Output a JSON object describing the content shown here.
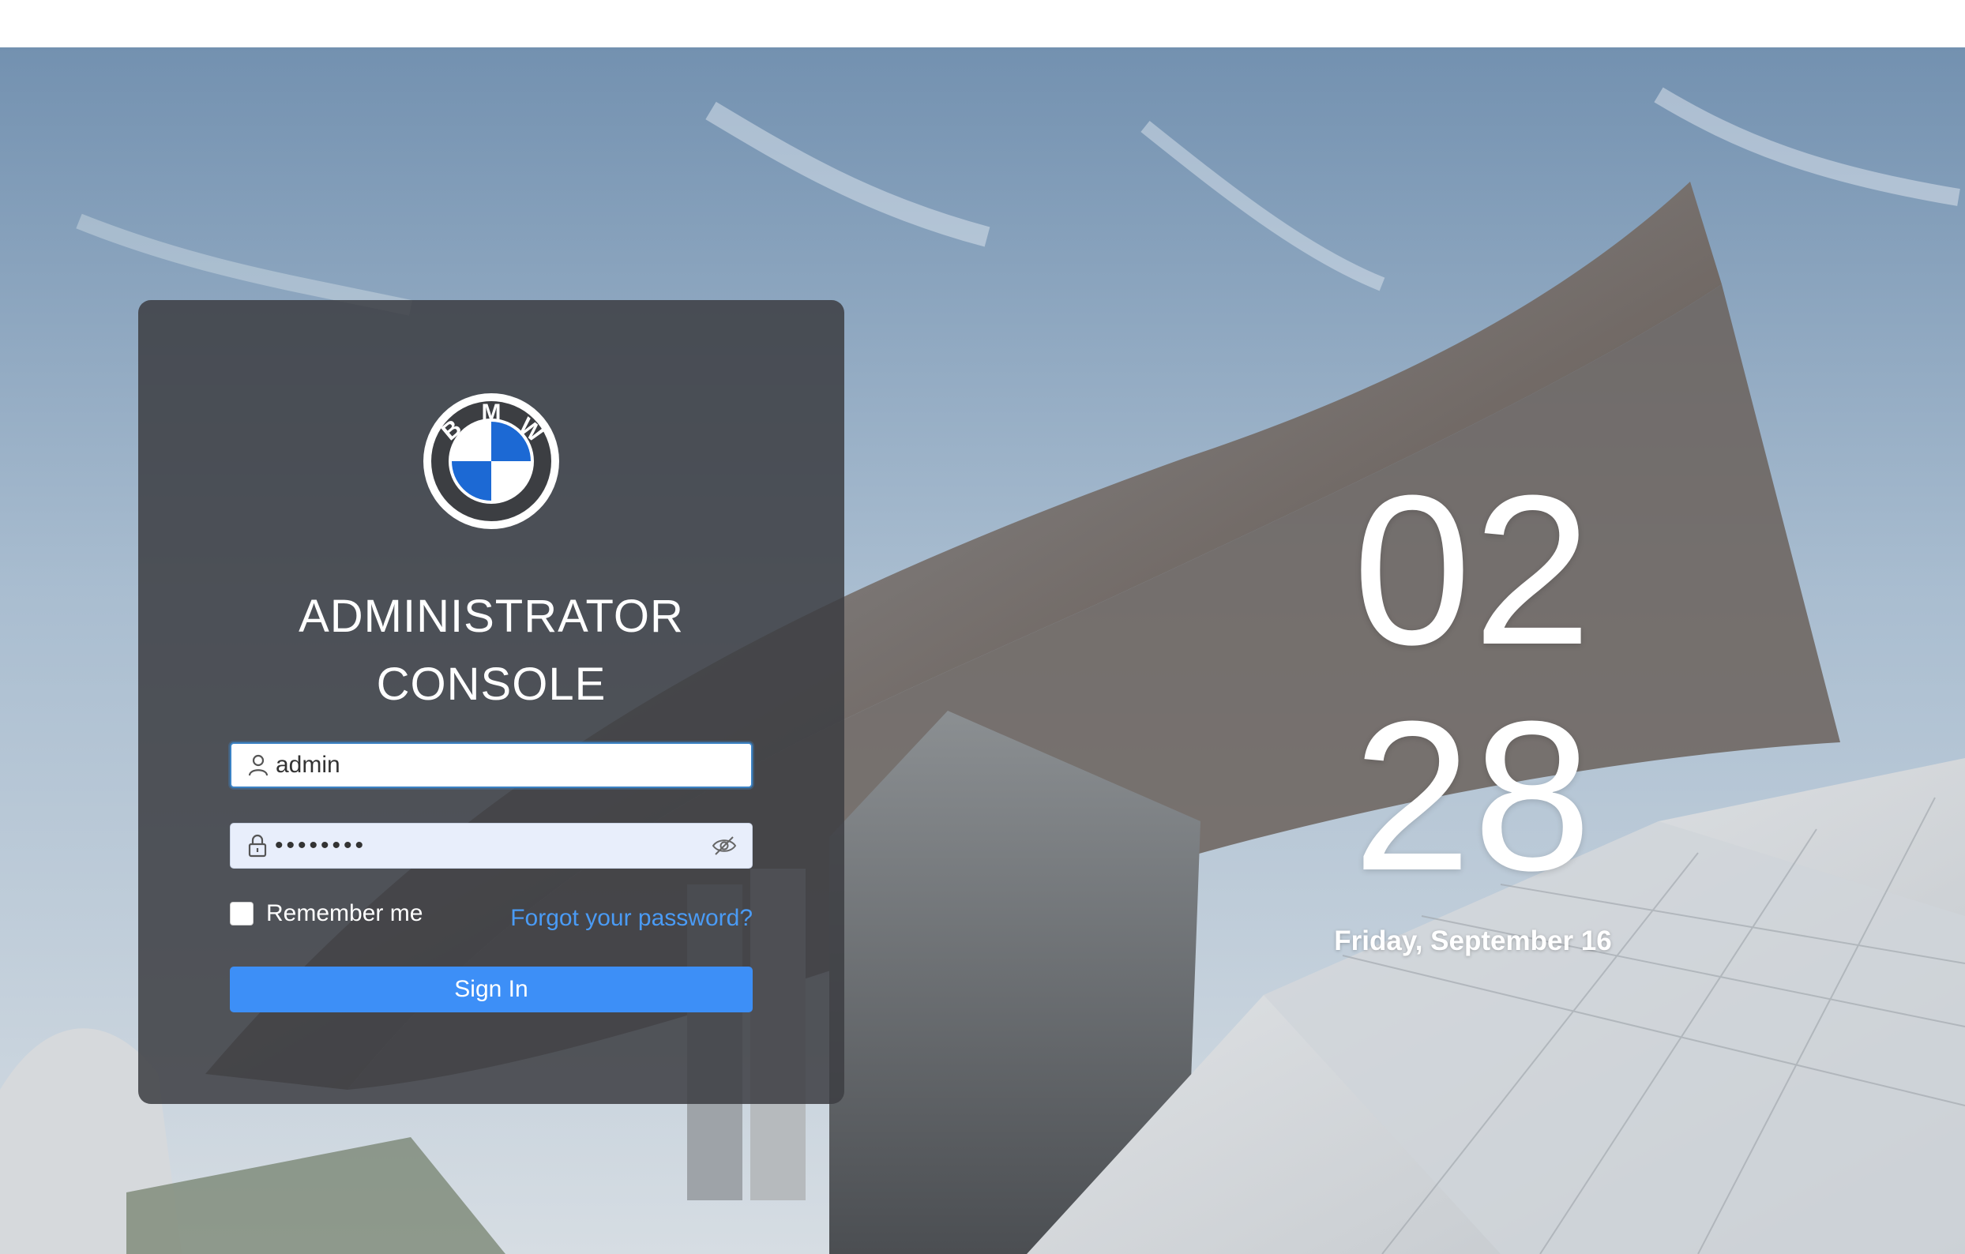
{
  "login": {
    "title_line1": "ADMINISTRATOR",
    "title_line2": "CONSOLE",
    "username_value": "admin",
    "password_value": "••••••••",
    "remember_label": "Remember me",
    "forgot_label": "Forgot your password?",
    "signin_label": "Sign In",
    "logo_letters": "BMW"
  },
  "clock": {
    "hours": "02",
    "minutes": "28",
    "date": "Friday, September 16"
  },
  "icons": {
    "username": "user-icon",
    "password": "lock-icon",
    "toggle_visibility": "eye-slash-icon"
  },
  "colors": {
    "primary": "#3d8ff7",
    "link": "#4a9bf5",
    "card": "#3c3e42",
    "bmw_blue": "#1c69d4"
  }
}
